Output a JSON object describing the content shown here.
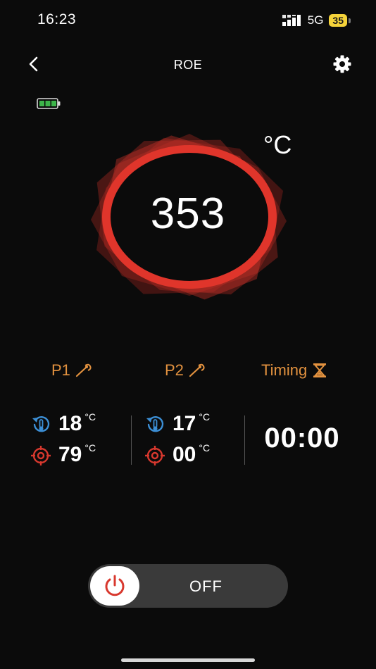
{
  "status_bar": {
    "time": "16:23",
    "network": "5G",
    "battery": "35",
    "icons": [
      "signal-icon",
      "battery-icon"
    ]
  },
  "nav": {
    "title": "ROE",
    "icons": [
      "back-icon",
      "gear-icon"
    ]
  },
  "device": {
    "battery_icon": "device-battery-icon",
    "battery_level": 1.0,
    "battery_color": "#3db54a"
  },
  "temperature": {
    "value": "353",
    "unit": "°C",
    "ring_color": "#e0352b"
  },
  "probes": [
    {
      "label": "P1",
      "icon": "probe-icon",
      "current": "18",
      "target": "79",
      "unit": "°C"
    },
    {
      "label": "P2",
      "icon": "probe-icon",
      "current": "17",
      "target": "00",
      "unit": "°C"
    }
  ],
  "timing": {
    "label": "Timing",
    "icon": "hourglass-icon",
    "value": "00:00"
  },
  "colors": {
    "accent": "#e3923f",
    "current_icon": "#3c8fd6",
    "target_icon": "#d8382e",
    "power_icon": "#d8382e"
  },
  "power_toggle": {
    "label": "OFF",
    "state": "off",
    "icon": "power-icon"
  }
}
